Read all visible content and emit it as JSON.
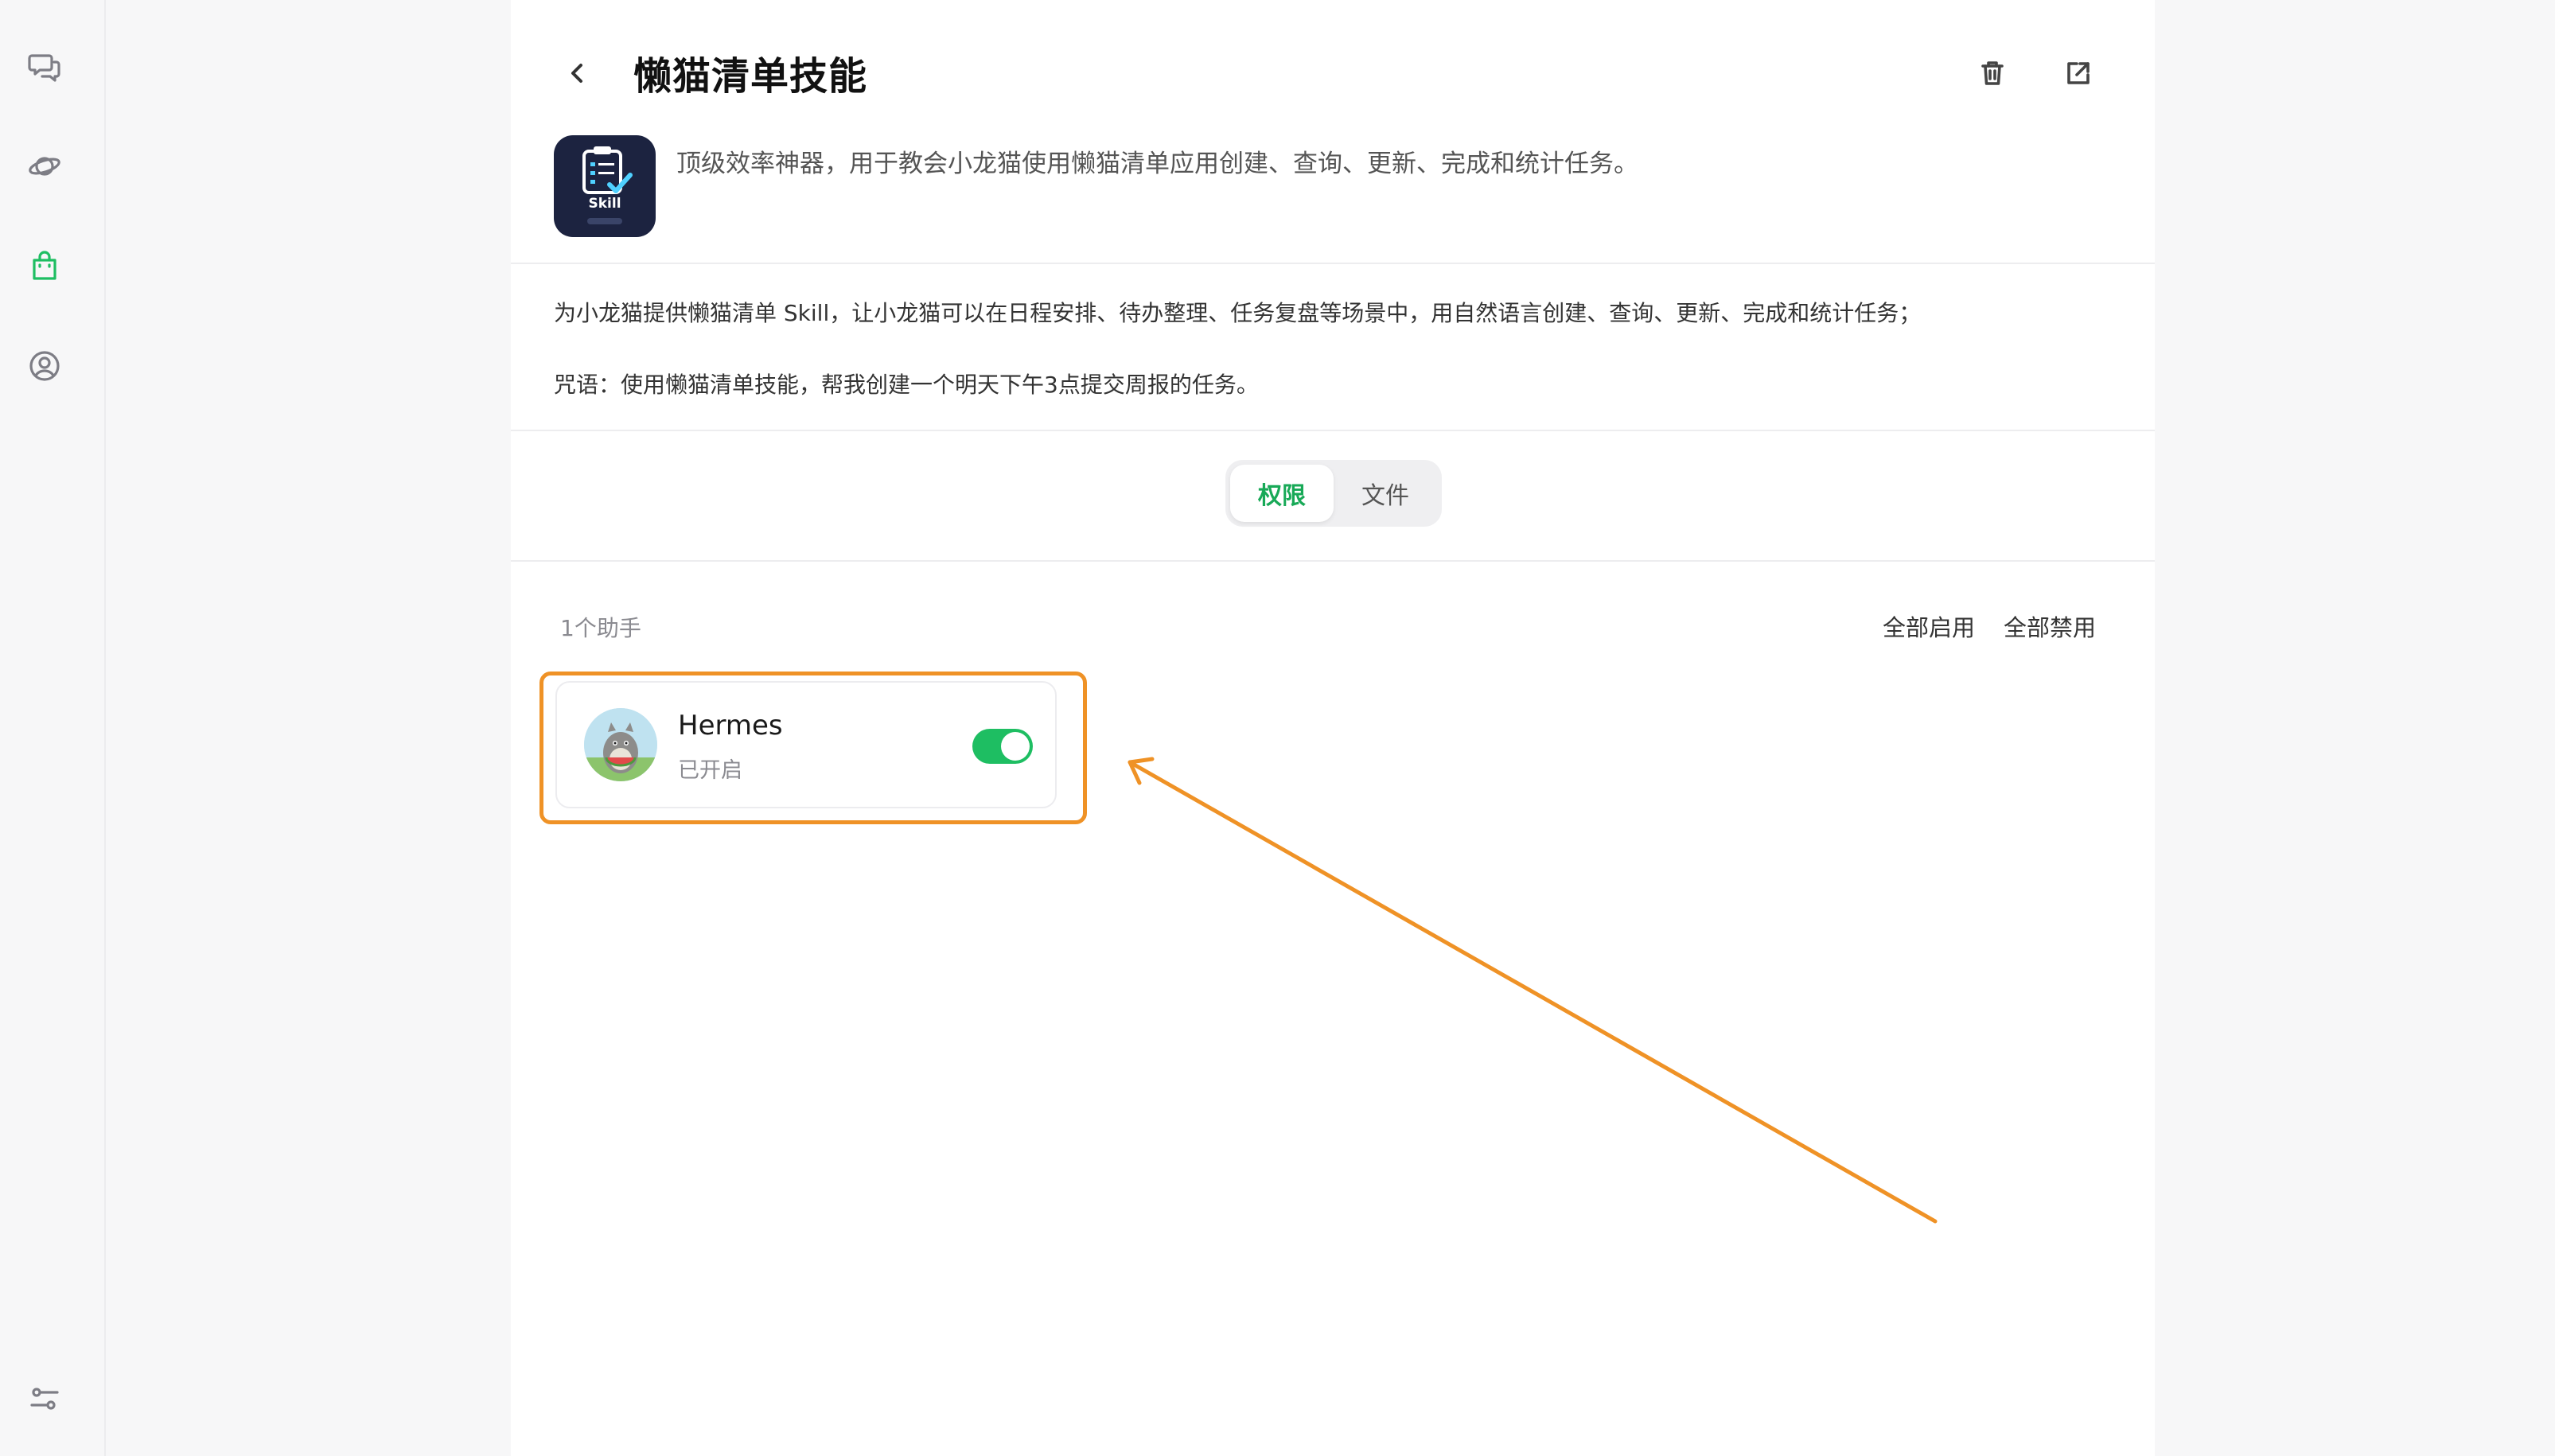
{
  "sidebar": {
    "items": [
      {
        "icon": "chat-icon",
        "active": false
      },
      {
        "icon": "planet-icon",
        "active": false
      },
      {
        "icon": "shopping-bag-icon",
        "active": true
      },
      {
        "icon": "user-circle-icon",
        "active": false
      }
    ],
    "bottom_icon": "settings-sliders-icon"
  },
  "header": {
    "title": "懒猫清单技能",
    "back_icon": "chevron-left-icon",
    "delete_icon": "trash-icon",
    "share_icon": "external-link-icon"
  },
  "skill": {
    "logo_text": "Skill",
    "summary": "顶级效率神器，用于教会小龙猫使用懒猫清单应用创建、查询、更新、完成和统计任务。"
  },
  "description": {
    "line1": "为小龙猫提供懒猫清单 Skill，让小龙猫可以在日程安排、待办整理、任务复盘等场景中，用自然语言创建、查询、更新、完成和统计任务；",
    "line2": "咒语：使用懒猫清单技能，帮我创建一个明天下午3点提交周报的任务。"
  },
  "tabs": {
    "items": [
      {
        "label": "权限",
        "active": true
      },
      {
        "label": "文件",
        "active": false
      }
    ]
  },
  "permissions": {
    "count_label": "1个助手",
    "enable_all": "全部启用",
    "disable_all": "全部禁用",
    "agents": [
      {
        "name": "Hermes",
        "status": "已开启",
        "enabled": true
      }
    ]
  },
  "colors": {
    "accent": "#1ebe62",
    "highlight": "#ef9226"
  }
}
